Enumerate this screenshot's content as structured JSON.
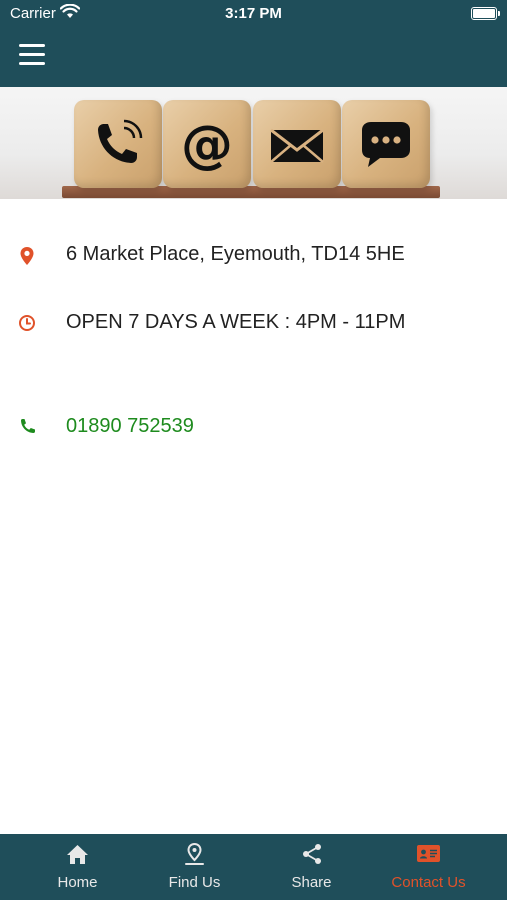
{
  "status_bar": {
    "carrier": "Carrier",
    "time": "3:17 PM"
  },
  "header": {
    "menu_icon": "hamburger-menu-icon"
  },
  "banner": {
    "icons": [
      "phone-icon",
      "at-sign-icon",
      "envelope-icon",
      "chat-bubble-icon"
    ]
  },
  "contact": {
    "address": "6 Market Place, Eyemouth, TD14 5HE",
    "hours": "OPEN 7 DAYS A WEEK : 4PM - 11PM",
    "phone": "01890 752539"
  },
  "tabs": [
    {
      "label": "Home",
      "icon": "home-icon",
      "active": false
    },
    {
      "label": "Find Us",
      "icon": "map-pin-icon",
      "active": false
    },
    {
      "label": "Share",
      "icon": "share-icon",
      "active": false
    },
    {
      "label": "Contact Us",
      "icon": "contact-card-icon",
      "active": true
    }
  ],
  "colors": {
    "header_bg": "#1f4e5a",
    "accent": "#e0522a",
    "phone_green": "#1e8b1e",
    "tab_inactive": "#e8e8e8"
  }
}
